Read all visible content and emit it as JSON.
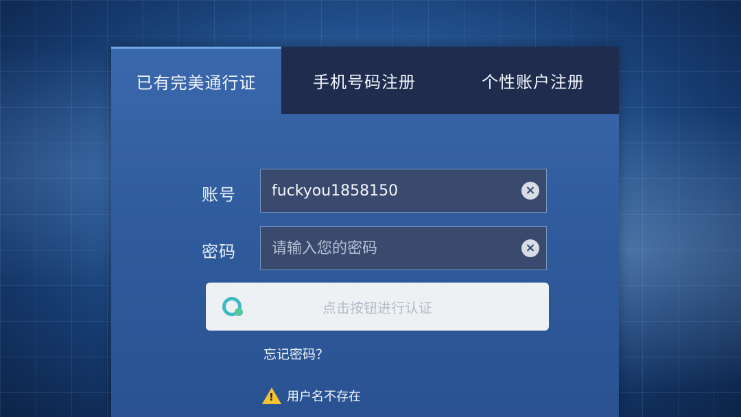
{
  "tabs": [
    {
      "label": "已有完美通行证",
      "active": true
    },
    {
      "label": "手机号码注册",
      "active": false
    },
    {
      "label": "个性账户注册",
      "active": false
    }
  ],
  "account": {
    "label": "账号",
    "value": "fuckyou1858150",
    "clear_icon": "close-circle-icon"
  },
  "password": {
    "label": "密码",
    "value": "",
    "placeholder": "请输入您的密码",
    "clear_icon": "close-circle-icon"
  },
  "verify": {
    "text": "点击按钮进行认证",
    "icon": "captcha-icon"
  },
  "forgot_password": "忘记密码？",
  "error": {
    "icon": "warning-icon",
    "text": "用户名不存在"
  },
  "colors": {
    "panel": "#2f5b9c",
    "inactive_tab": "#1f2c4e",
    "field": "#3a4a6e",
    "warning": "#f2c230"
  }
}
